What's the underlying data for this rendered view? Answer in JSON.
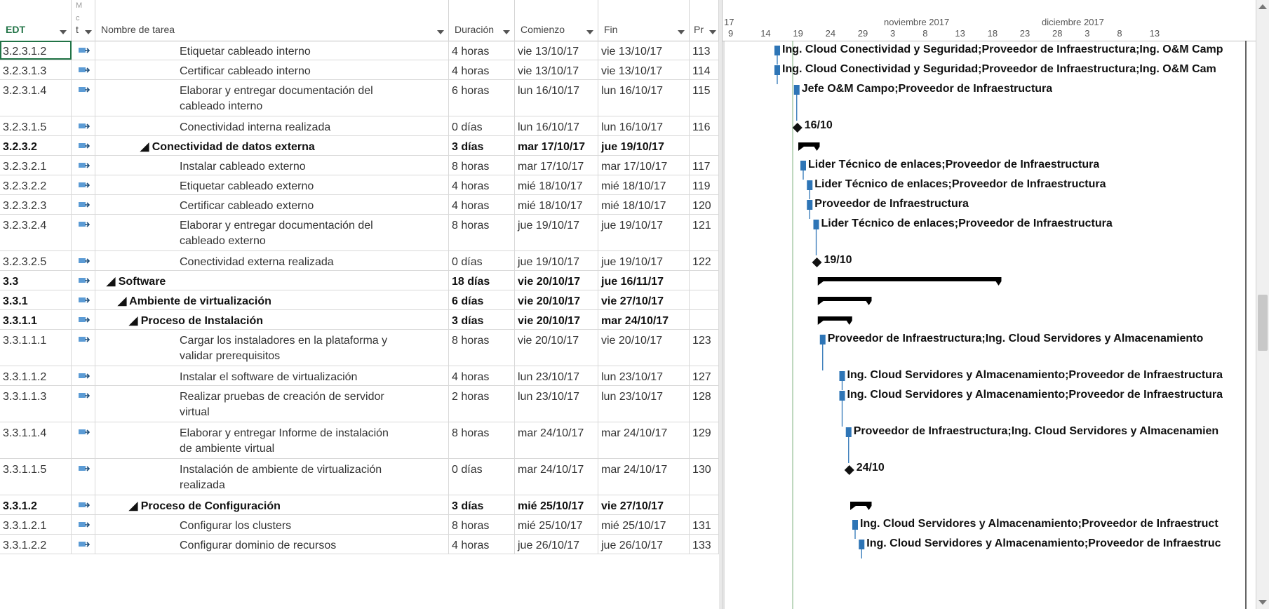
{
  "columns": {
    "edt": "EDT",
    "mode_top": "M",
    "mode_mid": "c",
    "mode_bot": "t",
    "name": "Nombre de tarea",
    "duration": "Duración",
    "start": "Comienzo",
    "finish": "Fin",
    "pred": "Pr"
  },
  "timescale": {
    "months": [
      "17",
      "noviembre 2017",
      "diciembre 2017"
    ],
    "days": [
      "9",
      "14",
      "19",
      "24",
      "29",
      "3",
      "8",
      "13",
      "18",
      "23",
      "28",
      "3",
      "8",
      "13"
    ]
  },
  "rows": [
    {
      "edt": "3.2.3.1.2",
      "name": "Etiquetar cableado interno",
      "name2": "",
      "dur": "4 horas",
      "start": "vie 13/10/17",
      "fin": "vie 13/10/17",
      "pred": "113",
      "summary": false,
      "indent": 0
    },
    {
      "edt": "3.2.3.1.3",
      "name": "Certificar cableado interno",
      "name2": "",
      "dur": "4 horas",
      "start": "vie 13/10/17",
      "fin": "vie 13/10/17",
      "pred": "114",
      "summary": false,
      "indent": 0
    },
    {
      "edt": "3.2.3.1.4",
      "name": "Elaborar y entregar documentación del",
      "name2": "cableado interno",
      "dur": "6 horas",
      "start": "lun 16/10/17",
      "fin": "lun 16/10/17",
      "pred": "115",
      "summary": false,
      "indent": 0
    },
    {
      "edt": "3.2.3.1.5",
      "name": "Conectividad interna realizada",
      "name2": "",
      "dur": "0 días",
      "start": "lun 16/10/17",
      "fin": "lun 16/10/17",
      "pred": "116",
      "summary": false,
      "indent": 0
    },
    {
      "edt": "3.2.3.2",
      "name": "◢ Conectividad de datos externa",
      "name2": "",
      "dur": "3 días",
      "start": "mar 17/10/17",
      "fin": "jue 19/10/17",
      "pred": "",
      "summary": true,
      "indent": -56
    },
    {
      "edt": "3.2.3.2.1",
      "name": "Instalar cableado externo",
      "name2": "",
      "dur": "8 horas",
      "start": "mar 17/10/17",
      "fin": "mar 17/10/17",
      "pred": "117",
      "summary": false,
      "indent": 0
    },
    {
      "edt": "3.2.3.2.2",
      "name": "Etiquetar cableado externo",
      "name2": "",
      "dur": "4 horas",
      "start": "mié 18/10/17",
      "fin": "mié 18/10/17",
      "pred": "119",
      "summary": false,
      "indent": 0
    },
    {
      "edt": "3.2.3.2.3",
      "name": "Certificar cableado externo",
      "name2": "",
      "dur": "4 horas",
      "start": "mié 18/10/17",
      "fin": "mié 18/10/17",
      "pred": "120",
      "summary": false,
      "indent": 0
    },
    {
      "edt": "3.2.3.2.4",
      "name": "Elaborar y entregar documentación del",
      "name2": "cableado externo",
      "dur": "8 horas",
      "start": "jue 19/10/17",
      "fin": "jue 19/10/17",
      "pred": "121",
      "summary": false,
      "indent": 0
    },
    {
      "edt": "3.2.3.2.5",
      "name": "Conectividad externa realizada",
      "name2": "",
      "dur": "0 días",
      "start": "jue 19/10/17",
      "fin": "jue 19/10/17",
      "pred": "122",
      "summary": false,
      "indent": 0
    },
    {
      "edt": "3.3",
      "name": "◢ Software",
      "name2": "",
      "dur": "18 días",
      "start": "vie 20/10/17",
      "fin": "jue 16/11/17",
      "pred": "",
      "summary": true,
      "indent": -104
    },
    {
      "edt": "3.3.1",
      "name": "◢ Ambiente de virtualización",
      "name2": "",
      "dur": "6 días",
      "start": "vie 20/10/17",
      "fin": "vie 27/10/17",
      "pred": "",
      "summary": true,
      "indent": -88
    },
    {
      "edt": "3.3.1.1",
      "name": "◢ Proceso de Instalación",
      "name2": "",
      "dur": "3 días",
      "start": "vie 20/10/17",
      "fin": "mar 24/10/17",
      "pred": "",
      "summary": true,
      "indent": -72
    },
    {
      "edt": "3.3.1.1.1",
      "name": "Cargar los instaladores en la plataforma y",
      "name2": "validar prerequisitos",
      "dur": "8 horas",
      "start": "vie 20/10/17",
      "fin": "vie 20/10/17",
      "pred": "123",
      "summary": false,
      "indent": 0
    },
    {
      "edt": "3.3.1.1.2",
      "name": "Instalar el software de virtualización",
      "name2": "",
      "dur": "4 horas",
      "start": "lun 23/10/17",
      "fin": "lun 23/10/17",
      "pred": "127",
      "summary": false,
      "indent": 0
    },
    {
      "edt": "3.3.1.1.3",
      "name": "Realizar pruebas de creación de servidor",
      "name2": "virtual",
      "dur": "2 horas",
      "start": "lun 23/10/17",
      "fin": "lun 23/10/17",
      "pred": "128",
      "summary": false,
      "indent": 0
    },
    {
      "edt": "3.3.1.1.4",
      "name": "Elaborar y entregar Informe de instalación",
      "name2": "de ambiente virtual",
      "dur": "8 horas",
      "start": "mar 24/10/17",
      "fin": "mar 24/10/17",
      "pred": "129",
      "summary": false,
      "indent": 0
    },
    {
      "edt": "3.3.1.1.5",
      "name": "Instalación de ambiente de virtualización",
      "name2": "realizada",
      "dur": "0 días",
      "start": "mar 24/10/17",
      "fin": "mar 24/10/17",
      "pred": "130",
      "summary": false,
      "indent": 0
    },
    {
      "edt": "3.3.1.2",
      "name": "◢ Proceso de Configuración",
      "name2": "",
      "dur": "3 días",
      "start": "mié 25/10/17",
      "fin": "vie 27/10/17",
      "pred": "",
      "summary": true,
      "indent": -72
    },
    {
      "edt": "3.3.1.2.1",
      "name": "Configurar los clusters",
      "name2": "",
      "dur": "8 horas",
      "start": "mié 25/10/17",
      "fin": "mié 25/10/17",
      "pred": "131",
      "summary": false,
      "indent": 0
    },
    {
      "edt": "3.3.1.2.2",
      "name": "Configurar dominio de recursos",
      "name2": "",
      "dur": "4 horas",
      "start": "jue 26/10/17",
      "fin": "jue 26/10/17",
      "pred": "133",
      "summary": false,
      "indent": 0
    }
  ],
  "gantt_labels": [
    "Ing. Cloud Conectividad y Seguridad;Proveedor de Infraestructura;Ing. O&M Camp",
    "Ing. Cloud Conectividad y Seguridad;Proveedor de Infraestructura;Ing. O&M Cam",
    "Jefe O&M Campo;Proveedor de Infraestructura",
    "16/10",
    "",
    "Lider Técnico de enlaces;Proveedor de Infraestructura",
    "Lider Técnico de enlaces;Proveedor de Infraestructura",
    "Proveedor de Infraestructura",
    "Lider Técnico de enlaces;Proveedor de Infraestructura",
    "19/10",
    "",
    "",
    "",
    "Proveedor de Infraestructura;Ing. Cloud Servidores y Almacenamiento",
    "Ing. Cloud Servidores y Almacenamiento;Proveedor de Infraestructura",
    "Ing. Cloud Servidores y Almacenamiento;Proveedor de Infraestructura",
    "Proveedor de Infraestructura;Ing. Cloud Servidores y Almacenamien",
    "24/10",
    "",
    "Ing. Cloud Servidores y Almacenamiento;Proveedor de Infraestruct",
    "Ing. Cloud Servidores y Almacenamiento;Proveedor de Infraestruc"
  ],
  "colors": {
    "task_bar": "#2e75b6",
    "summary_bar": "#000000",
    "link": "#2e75b6",
    "selected_border": "#217346"
  }
}
